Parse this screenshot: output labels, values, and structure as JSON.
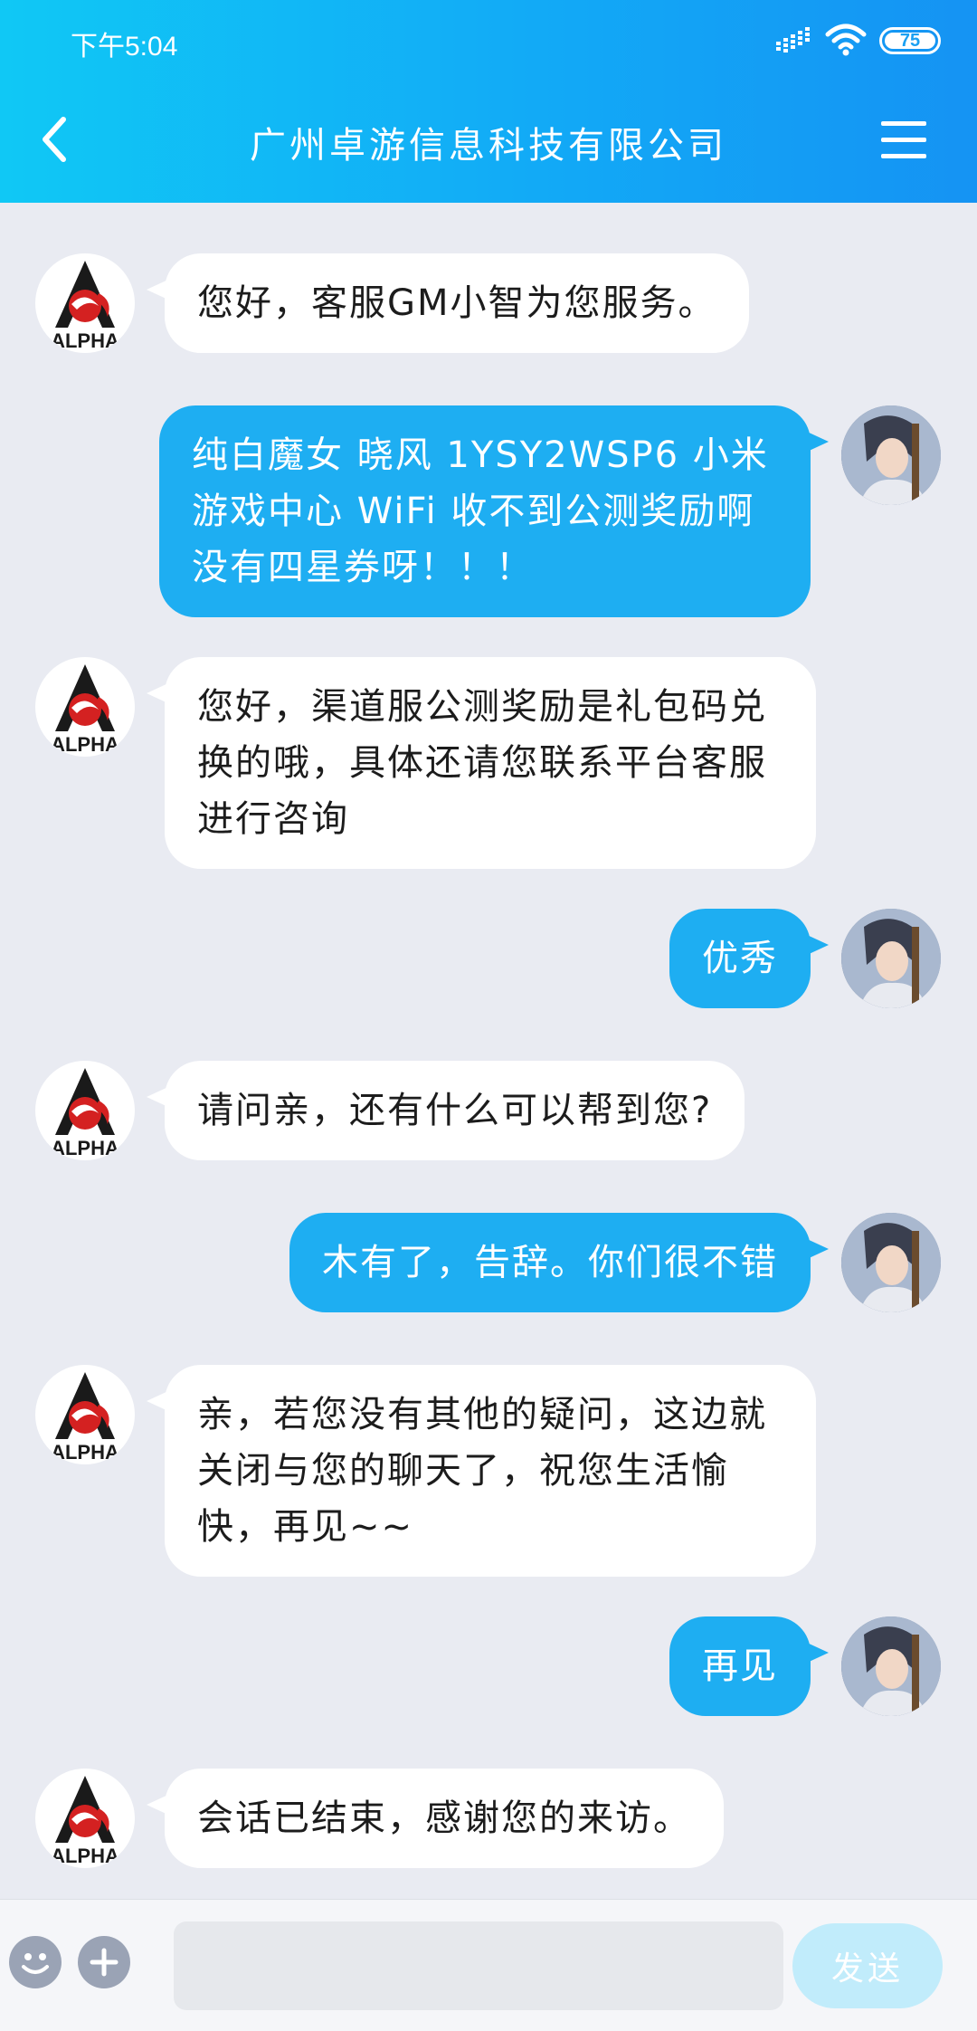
{
  "status_bar": {
    "time": "下午5:04",
    "battery": "75",
    "icons": [
      "signal-icon",
      "wifi-icon",
      "battery-icon"
    ]
  },
  "header": {
    "title": "广州卓游信息科技有限公司",
    "back_icon": "chevron-left-icon",
    "menu_icon": "hamburger-menu-icon"
  },
  "cs_avatar_text": "ALPHA",
  "messages": [
    {
      "sender": "cs",
      "text": "您好，客服GM小智为您服务。"
    },
    {
      "sender": "user",
      "text": "纯白魔女 晓风 1YSY2WSP6 小米游戏中心 WiFi 收不到公测奖励啊 没有四星券呀！！！"
    },
    {
      "sender": "cs",
      "text": "您好，渠道服公测奖励是礼包码兑换的哦，具体还请您联系平台客服进行咨询"
    },
    {
      "sender": "user",
      "text": "优秀"
    },
    {
      "sender": "cs",
      "text": "请问亲，还有什么可以帮到您?"
    },
    {
      "sender": "user",
      "text": "木有了，告辞。你们很不错"
    },
    {
      "sender": "cs",
      "text": "亲，若您没有其他的疑问，这边就关闭与您的聊天了，祝您生活愉快，再见~~"
    },
    {
      "sender": "user",
      "text": "再见"
    },
    {
      "sender": "cs",
      "text": "会话已结束，感谢您的来访。"
    }
  ],
  "input_bar": {
    "placeholder": "",
    "value": "",
    "send_label": "发送",
    "emoji_icon": "smiley-icon",
    "plus_icon": "plus-icon"
  },
  "colors": {
    "header_gradient_start": "#10c8f5",
    "header_gradient_end": "#1593f3",
    "user_bubble": "#1eaef2",
    "cs_bubble": "#ffffff",
    "chat_background": "#e9ebf2",
    "send_button_disabled": "#c1ecfb"
  }
}
